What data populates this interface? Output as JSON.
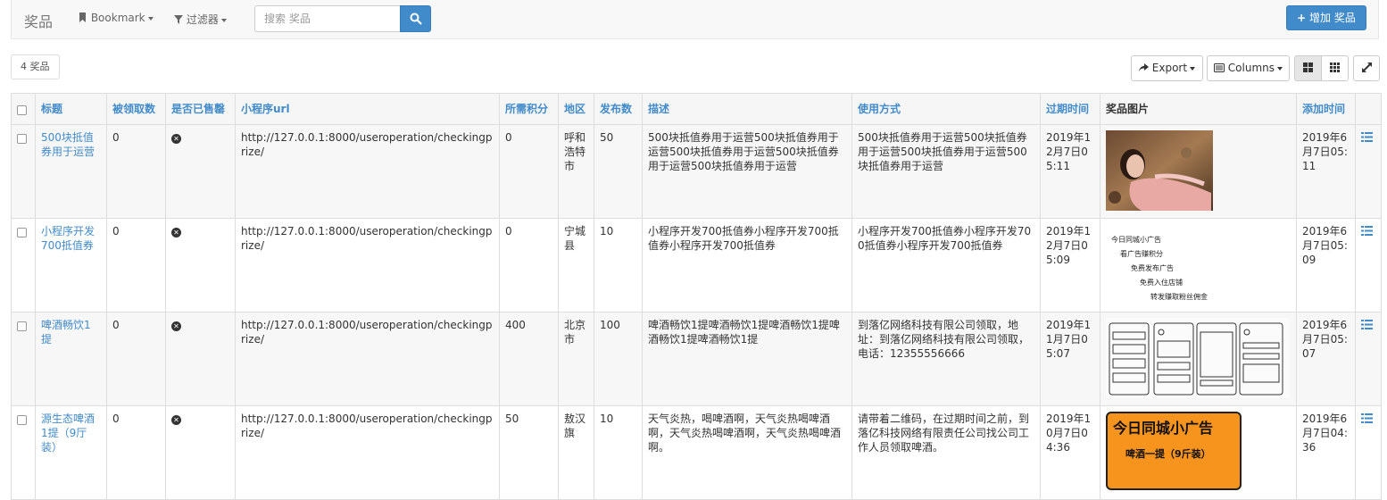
{
  "navbar": {
    "brand": "奖品",
    "bookmark": "Bookmark",
    "filter": "过滤器",
    "search_placeholder": "搜索 奖品",
    "add_button": "增加 奖品"
  },
  "toolbar": {
    "count": "4 奖品",
    "export": "Export",
    "columns": "Columns"
  },
  "table": {
    "headers": [
      "标题",
      "被领取数",
      "是否已售罄",
      "小程序url",
      "所需积分",
      "地区",
      "发布数",
      "描述",
      "使用方式",
      "过期时间",
      "奖品图片",
      "添加时间"
    ],
    "rows": [
      {
        "title": "500块抵值券用于运营",
        "claimed": "0",
        "url": "http://127.0.0.1:8000/useroperation/checkingprize/",
        "points": "0",
        "region": "呼和浩特市",
        "published": "50",
        "desc": "500块抵值券用于运营500块抵值券用于运营500块抵值券用于运营500块抵值券用于运营500块抵值券用于运营",
        "usage": "500块抵值券用于运营500块抵值券用于运营500块抵值券用于运营500块抵值券用于运营",
        "expire": "2019年12月7日05:11",
        "added": "2019年6月7日05:11"
      },
      {
        "title": "小程序开发700抵值券",
        "claimed": "0",
        "url": "http://127.0.0.1:8000/useroperation/checkingprize/",
        "points": "0",
        "region": "宁城县",
        "published": "10",
        "desc": "小程序开发700抵值券小程序开发700抵值券小程序开发700抵值券",
        "usage": "小程序开发700抵值券小程序开发700抵值券小程序开发700抵值券",
        "expire": "2019年12月7日05:09",
        "added": "2019年6月7日05:09",
        "img_lines": [
          "今日同城小广告",
          "看广告赚积分",
          "免费发布广告",
          "免费入住店铺",
          "转发赚取粉丝佣金"
        ]
      },
      {
        "title": "啤酒畅饮1提",
        "claimed": "0",
        "url": "http://127.0.0.1:8000/useroperation/checkingprize/",
        "points": "400",
        "region": "北京市",
        "published": "100",
        "desc": "啤酒畅饮1提啤酒畅饮1提啤酒畅饮1提啤酒畅饮1提啤酒畅饮1提",
        "usage": "到落亿网络科技有限公司领取，地址：到落亿网络科技有限公司领取，电话：12355556666",
        "expire": "2019年11月7日05:07",
        "added": "2019年6月7日05:07"
      },
      {
        "title": "源生态啤酒1提（9厅装）",
        "claimed": "0",
        "url": "http://127.0.0.1:8000/useroperation/checkingprize/",
        "points": "50",
        "region": "敖汉旗",
        "published": "10",
        "desc": "天气炎热，喝啤酒啊，天气炎热喝啤酒啊，天气炎热喝啤酒啊，天气炎热喝啤酒啊。",
        "usage": "请带着二维码，在过期时间之前，到落亿科技网络有限责任公司找公司工作人员领取啤酒。",
        "expire": "2019年10月7日04:36",
        "added": "2019年6月7日04:36",
        "img_lines": [
          "今日同城小广告",
          "啤酒一提（9斤装）"
        ]
      }
    ]
  }
}
